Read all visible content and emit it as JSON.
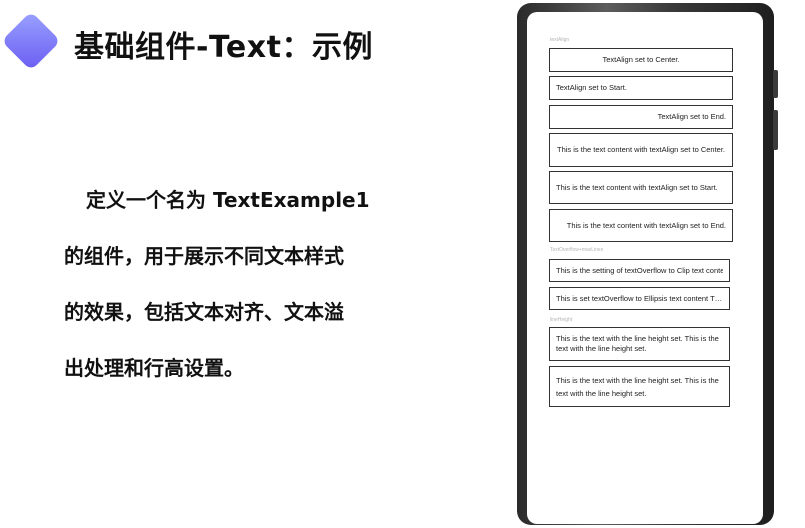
{
  "slide": {
    "title": "基础组件-Text：示例",
    "description_lines": [
      "定义一个名为 TextExample1",
      "的组件，用于展示不同文本样式",
      "的效果，包括文本对齐、文本溢",
      "出处理和行高设置。"
    ],
    "accent_color": "#7b72f5"
  },
  "phone_screen": {
    "section_textalign": {
      "label": "textAlign",
      "items": [
        "TextAlign set to Center.",
        "TextAlign set to Start.",
        "TextAlign set to End.",
        "This is the text content with textAlign set to Center.",
        "This is the text content with textAlign set to Start.",
        "This is the text content with textAlign set to End."
      ]
    },
    "section_overflow": {
      "label": "TextOverflow+maxLines",
      "items": [
        "This is the setting of textOverflow to Clip text content This is the setting",
        "This is set textOverflow to Ellipsis text content This is set textOverflow"
      ]
    },
    "section_lineheight": {
      "label": "lineHeight",
      "items": [
        "This is the text with the line height set. This is the text with the line height set.",
        "This is the text with the line height set. This is the text with the line height set."
      ]
    }
  }
}
